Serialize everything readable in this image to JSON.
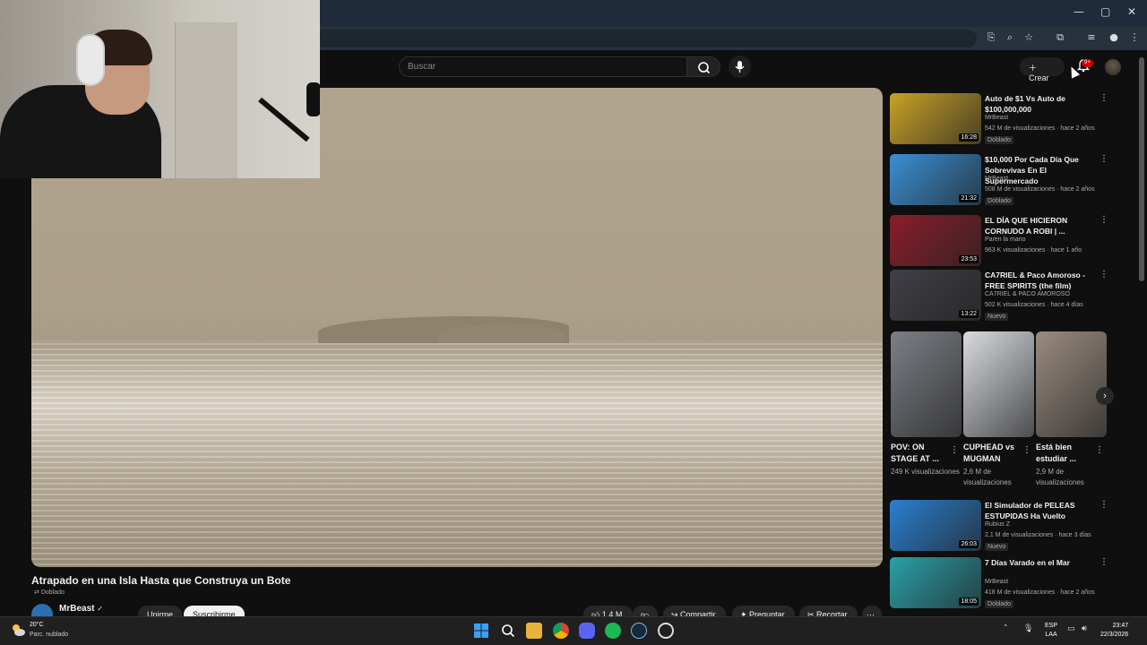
{
  "window": {
    "minimize": "—",
    "maximize": "▢",
    "close": "✕"
  },
  "youtube": {
    "search_placeholder": "Buscar",
    "create_label": "Crear",
    "notification_count": "9+"
  },
  "video": {
    "title": "Atrapado en una Isla Hasta que Construya un Bote",
    "dubbed": "Doblado",
    "channel": "MrBeast",
    "join_label": "Unirme",
    "subscribe_label": "Suscribirme",
    "likes": "1,4 M",
    "share_label": "Compartir",
    "ask_label": "Preguntar",
    "clip_label": "Recortar"
  },
  "recommendations": [
    {
      "title": "Auto de $1 Vs Auto de $100,000,000",
      "channel": "MrBeast",
      "meta": "542 M de visualizaciones · hace 2 años",
      "badge": "Doblado",
      "duration": "16:28",
      "thumb_color": "#c9a227"
    },
    {
      "title": "$10,000 Por Cada Día Que Sobrevivas En El Supermercado",
      "channel": "MrBeast",
      "meta": "508 M de visualizaciones · hace 2 años",
      "badge": "Doblado",
      "duration": "21:32",
      "thumb_color": "#3a8fd4"
    },
    {
      "title": "EL DÍA QUE HICIERON CORNUDO A ROBI | ...",
      "channel": "Paren la mano",
      "meta": "963 K visualizaciones · hace 1 año",
      "badge": "",
      "duration": "23:53",
      "thumb_color": "#8a1d2a"
    },
    {
      "title": "CA7RIEL & Paco Amoroso - FREE SPIRITS (the film)",
      "channel": "CA7RIEL & PACO AMOROSO",
      "meta": "502 K visualizaciones · hace 4 días",
      "badge": "Nuevo",
      "duration": "13:22",
      "thumb_color": "#3f3f46"
    }
  ],
  "shorts": [
    {
      "title": "POV: ON STAGE AT ...",
      "views": "249 K visualizaciones",
      "thumb_color": "#7d7f86"
    },
    {
      "title": "CUPHEAD vs MUGMAN",
      "views": "2,6 M de visualizaciones",
      "thumb_color": "#d9dbe0"
    },
    {
      "title": "Está bien estudiar ...",
      "views": "2,9 M de visualizaciones",
      "thumb_color": "#9a8c80"
    }
  ],
  "recommendations_more": [
    {
      "title": "El Simulador de PELEAS ESTUPIDAS Ha Vuelto",
      "channel": "Rubius Z",
      "meta": "2,1 M de visualizaciones · hace 3 días",
      "badge": "Nuevo",
      "duration": "26:03",
      "thumb_color": "#2a7fd0"
    },
    {
      "title": "7 Días Varado en el Mar",
      "channel": "MrBeast",
      "meta": "418 M de visualizaciones · hace 2 años",
      "badge": "Doblado",
      "duration": "18:05",
      "thumb_color": "#2aa0a8"
    }
  ],
  "taskbar": {
    "weather_temp": "20°C",
    "weather_desc": "Parc. nublado",
    "lang_top": "ESP",
    "lang_bottom": "LAA",
    "time": "23:47",
    "date": "22/3/2026"
  }
}
